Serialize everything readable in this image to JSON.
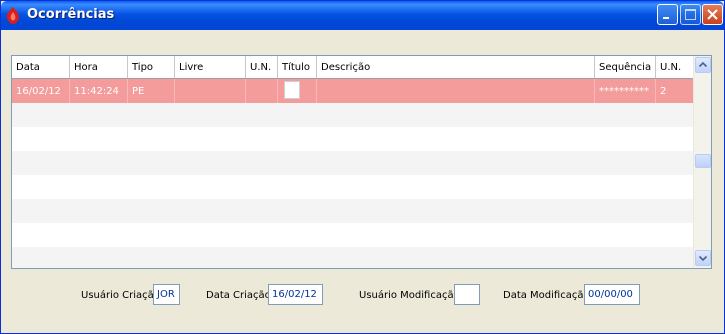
{
  "window": {
    "title": "Ocorrências"
  },
  "grid": {
    "headers": [
      "Data",
      "Hora",
      "Tipo",
      "Livre",
      "U.N.",
      "Título",
      "Descrição",
      "Sequência",
      "U.N."
    ],
    "rows": [
      {
        "data": "16/02/12",
        "hora": "11:42:24",
        "tipo": "PE",
        "livre": "",
        "un": "",
        "titulo": "",
        "descricao": "",
        "sequencia": "**********",
        "un2": "2",
        "selected": true
      }
    ]
  },
  "footer": {
    "usuario_criacao_label": "Usuário Criação",
    "usuario_criacao_value": "JOR",
    "data_criacao_label": "Data Criação",
    "data_criacao_value": "16/02/12",
    "usuario_modificacao_label": "Usuário Modificação",
    "usuario_modificacao_value": "",
    "data_modificacao_label": "Data Modificação",
    "data_modificacao_value": "00/00/00"
  },
  "colors": {
    "selected_row": "#F39C9B",
    "titlebar": "#0553E3",
    "field_text": "#003399"
  },
  "icons": {
    "app": "red-flame-icon",
    "minimize": "minimize-icon",
    "maximize": "maximize-icon",
    "close": "close-icon",
    "scroll_up": "chevron-up-icon",
    "scroll_down": "chevron-down-icon"
  }
}
